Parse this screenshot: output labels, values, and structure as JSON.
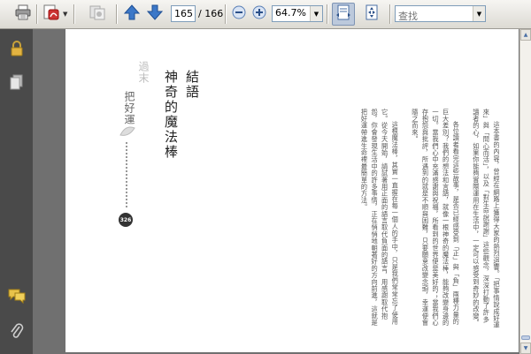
{
  "toolbar": {
    "current_page": "165",
    "page_total": "/ 166",
    "zoom": "64.7%",
    "search_placeholder": "查找"
  },
  "icons": {
    "print": "printer-icon",
    "create_pdf": "create-pdf-icon",
    "collaborate": "collaborate-icon",
    "prev_page": "arrow-up-icon",
    "next_page": "arrow-down-icon",
    "zoom_out": "minus-circle-icon",
    "zoom_in": "plus-circle-icon",
    "fit_width": "fit-width-icon",
    "fit_page": "fit-page-icon",
    "security": "lock-icon",
    "pages": "pages-icon",
    "comments": "speech-bubbles-icon",
    "attachments": "paperclip-icon"
  },
  "document": {
    "chapter_title_1": "結語",
    "chapter_title_2": "神奇的魔法棒",
    "side_title": "過末",
    "side_title_sub": "把好運",
    "page_number": "326",
    "paragraphs": [
      "這本書的內容，曾經在網路上獲得大家的熱烈迴響。「把事情說成好運來」與「問心而活」，以及「對生命說謝謝」這些觀念，深深打動了許多讀者的心，如果你能夠實際運用在生活中，一定可以感受到奇妙的改變。",
      "各位讀者看完這些故事，是否已經感受到「正」與「負」兩種力量的巨大差別？我們的想法和言語，就像一根神奇的魔法棒，能夠改變身邊的一切。當我們心中充滿感謝與祝福，所看到的世界便是美好的；當我們心存抱怨與批評，所遇到的就是不順與困難，只要願意改變念頭，幸運便會隨之而來。",
      "這根魔法棒，其實一直握在每一個人的手中，只是我們常常忘了使用它。從今天開始，請試著用正面的語言取代負面的語言，用感謝取代抱怨，你會發現生活中的許多事情，正在悄悄地朝著好的方向前進，這就是把好運帶進生命裡最簡單的方法。"
    ]
  },
  "colors": {
    "toolbar_bg": "#e8e6e0",
    "navpane_bg": "#4a4a4a",
    "doc_bg": "#707070",
    "page_bg": "#ffffff",
    "accent_blue": "#3c78c8"
  }
}
